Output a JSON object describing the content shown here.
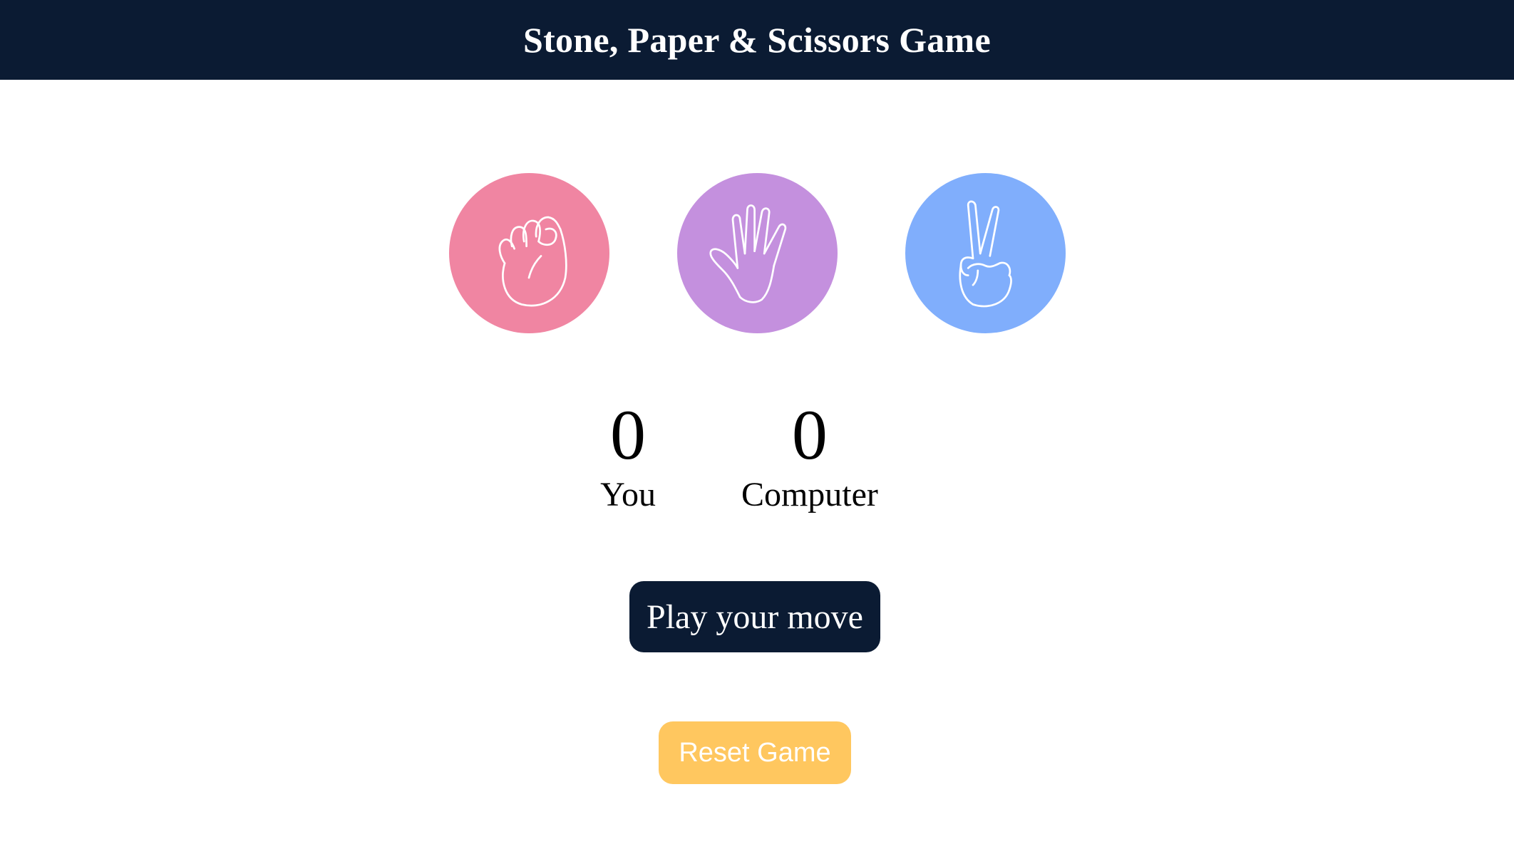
{
  "header": {
    "title": "Stone, Paper & Scissors Game"
  },
  "choices": [
    {
      "name": "stone",
      "icon": "fist-icon",
      "color": "#f085a2"
    },
    {
      "name": "paper",
      "icon": "open-hand-icon",
      "color": "#c490de"
    },
    {
      "name": "scissors",
      "icon": "peace-hand-icon",
      "color": "#80aefc"
    }
  ],
  "scoreboard": {
    "user": {
      "score": "0",
      "label": "You"
    },
    "computer": {
      "score": "0",
      "label": "Computer"
    }
  },
  "message": {
    "text": "Play your move",
    "background": "#0b1b33"
  },
  "reset": {
    "label": "Reset Game",
    "background": "#ffc75f"
  }
}
